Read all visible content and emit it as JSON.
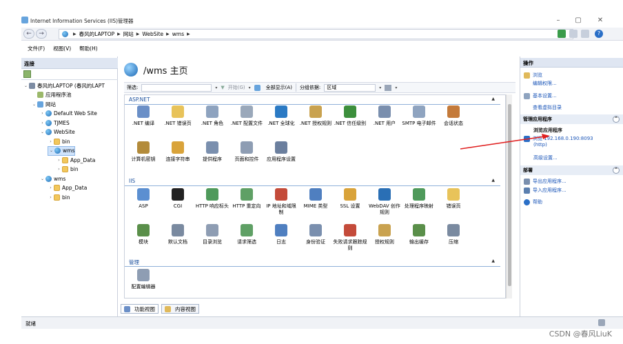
{
  "window": {
    "title": "Internet Information Services (IIS)管理器"
  },
  "address": {
    "crumbs": [
      "春风的LAPTOP",
      "网站",
      "WebSite",
      "wms"
    ]
  },
  "menu": [
    "文件(F)",
    "视图(V)",
    "帮助(H)"
  ],
  "connections": {
    "header": "连接",
    "tree": [
      {
        "label": "春风的LAPTOP (春风的LAPT",
        "toggle": "⌄",
        "icon": "server"
      },
      {
        "label": "应用程序池",
        "toggle": "",
        "icon": "pool"
      },
      {
        "label": "网站",
        "toggle": "⌄",
        "icon": "sites"
      },
      {
        "label": "Default Web Site",
        "toggle": "›",
        "icon": "globe"
      },
      {
        "label": "TJMES",
        "toggle": "›",
        "icon": "globe"
      },
      {
        "label": "WebSite",
        "toggle": "⌄",
        "icon": "globe"
      },
      {
        "label": "bin",
        "toggle": "›",
        "icon": "folder"
      },
      {
        "label": "wms",
        "toggle": "⌄",
        "icon": "globe"
      },
      {
        "label": "App_Data",
        "toggle": "›",
        "icon": "folder"
      },
      {
        "label": "bin",
        "toggle": "›",
        "icon": "folder"
      },
      {
        "label": "wms",
        "toggle": "⌄",
        "icon": "globe"
      },
      {
        "label": "App_Data",
        "toggle": "›",
        "icon": "folder"
      },
      {
        "label": "bin",
        "toggle": "›",
        "icon": "folder"
      }
    ]
  },
  "page": {
    "title": "/wms 主页",
    "filter_label": "筛选:",
    "start_label": "开始(G)",
    "show_all_label": "全部显示(A)",
    "group_by_label": "分组依据:",
    "group_by_value": "区域"
  },
  "groups": [
    {
      "name": "ASP.NET",
      "items": [
        {
          "label": ".NET 编译",
          "color": "#6a8fc7"
        },
        {
          "label": ".NET 错误页",
          "color": "#e8c35a"
        },
        {
          "label": ".NET 角色",
          "color": "#8ea3bf"
        },
        {
          "label": ".NET 配置文件",
          "color": "#9aa8ba"
        },
        {
          "label": ".NET 全球化",
          "color": "#2b7ac4"
        },
        {
          "label": ".NET 授权规则",
          "color": "#c9a24f"
        },
        {
          "label": ".NET 信任级别",
          "color": "#3c8f3c"
        },
        {
          "label": ".NET 用户",
          "color": "#7a8fae"
        },
        {
          "label": "SMTP 电子邮件",
          "color": "#8fa4c0"
        },
        {
          "label": "会话状态",
          "color": "#c47a3a"
        },
        {
          "label": "计算机密钥",
          "color": "#b38b3a"
        },
        {
          "label": "连接字符串",
          "color": "#d9a33a"
        },
        {
          "label": "提供程序",
          "color": "#7a8fae"
        },
        {
          "label": "页面和控件",
          "color": "#8e9db3"
        },
        {
          "label": "应用程序设置",
          "color": "#6b7f9e"
        }
      ]
    },
    {
      "name": "IIS",
      "items": [
        {
          "label": "ASP",
          "color": "#5b8fd1"
        },
        {
          "label": "CGI",
          "color": "#222222"
        },
        {
          "label": "HTTP 响应标头",
          "color": "#4f9a5b"
        },
        {
          "label": "HTTP 重定向",
          "color": "#5fa065"
        },
        {
          "label": "IP 地址和域限制",
          "color": "#c44b3a"
        },
        {
          "label": "MIME 类型",
          "color": "#4f7fc0"
        },
        {
          "label": "SSL 设置",
          "color": "#d9a33a"
        },
        {
          "label": "WebDAV 创作规则",
          "color": "#2a6fb5"
        },
        {
          "label": "处理程序映射",
          "color": "#4f9a5b"
        },
        {
          "label": "错误页",
          "color": "#e8c35a"
        },
        {
          "label": "模块",
          "color": "#5a8f4a"
        },
        {
          "label": "默认文档",
          "color": "#7a8aa0"
        },
        {
          "label": "目录浏览",
          "color": "#8e9db3"
        },
        {
          "label": "请求筛选",
          "color": "#5fa065"
        },
        {
          "label": "日志",
          "color": "#4f7fc0"
        },
        {
          "label": "身份验证",
          "color": "#7a8fae"
        },
        {
          "label": "失败请求跟踪规则",
          "color": "#c44b3a"
        },
        {
          "label": "授权规则",
          "color": "#c9a24f"
        },
        {
          "label": "输出缓存",
          "color": "#5a8f4a"
        },
        {
          "label": "压缩",
          "color": "#7a8aa0"
        }
      ]
    },
    {
      "name": "管理",
      "items": [
        {
          "label": "配置编辑器",
          "color": "#8e9db3"
        }
      ]
    }
  ],
  "view_tabs": {
    "features": "功能视图",
    "content": "内容视图"
  },
  "actions": {
    "header": "操作",
    "explore": "浏览",
    "edit_permissions": "编辑权限...",
    "basic_settings": "基本设置...",
    "view_vdirs": "查看虚拟目录",
    "manage_app": "管理应用程序",
    "browse_app": "浏览应用程序",
    "browse_url": "浏览 192.168.0.190:8093",
    "browse_url_proto": "(http)",
    "advanced": "高级设置...",
    "deploy": "部署",
    "export_app": "导出应用程序...",
    "import_app": "导入应用程序...",
    "help": "帮助"
  },
  "status": {
    "text": "就绪"
  },
  "watermark": "CSDN @春风LiuK"
}
